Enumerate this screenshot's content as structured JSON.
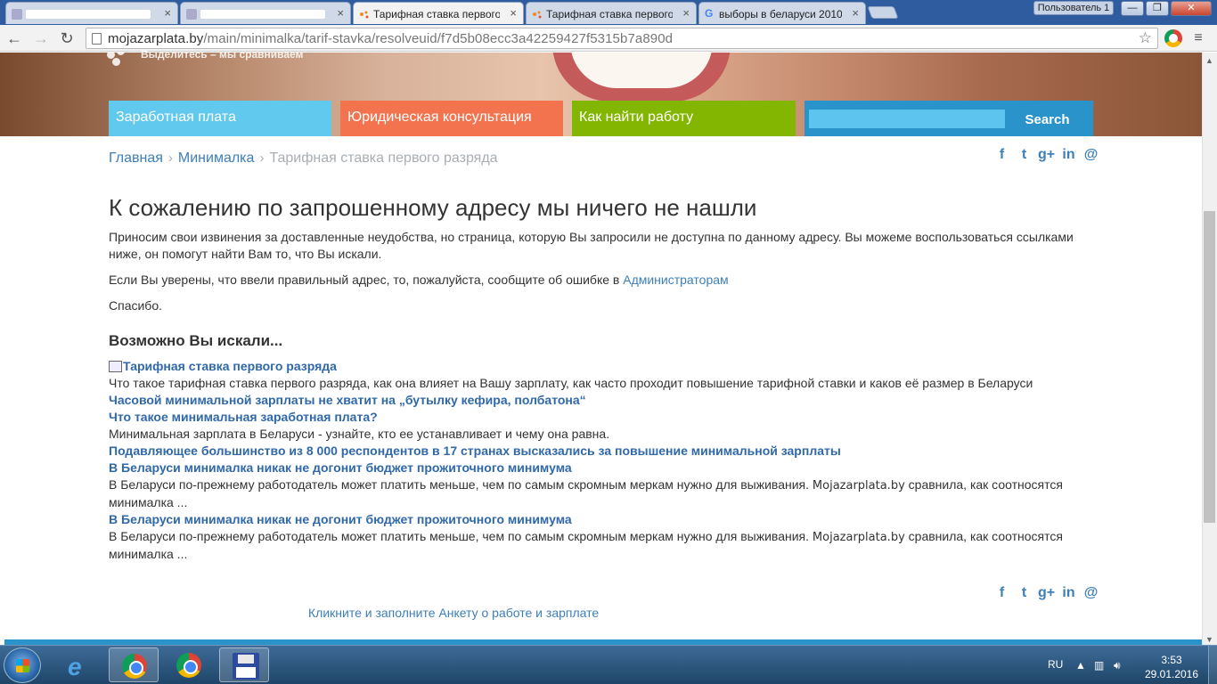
{
  "browser": {
    "tabs": [
      {
        "label": ""
      },
      {
        "label": ""
      },
      {
        "label": "Тарифная ставка первого"
      },
      {
        "label": "Тарифная ставка первого"
      },
      {
        "label": "выборы в беларуси 2010"
      }
    ],
    "profile_label": "Пользователь 1",
    "url_host": "mojazarplata.by",
    "url_path": "/main/minimalka/tarif-stavka/resolveuid/f7d5b08ecc3a42259427f5315b7a890d"
  },
  "site": {
    "slogan": "Выделитесь – мы сравниваем",
    "nav": {
      "salary": "Заработная плата",
      "legal": "Юридическая консультация",
      "job": "Как найти работу",
      "search_button": "Search",
      "search_placeholder": ""
    },
    "breadcrumb": {
      "home": "Главная",
      "section": "Минималка",
      "current": "Тарифная ставка первого разряда"
    },
    "social_icons": [
      "facebook-icon",
      "twitter-icon",
      "google-plus-icon",
      "linkedin-icon",
      "email-icon"
    ],
    "brand_colors": {
      "salary": "#61c8ee",
      "legal": "#f4734f",
      "job": "#83b600",
      "search": "#2a93c9",
      "link": "#3068a8"
    }
  },
  "content": {
    "heading": "К сожалению по запрошенному адресу мы ничего не нашли",
    "para1": "Приносим свои извинения за доставленные неудобства, но страница, которую Вы запросили не доступна по данному адресу. Вы можеме воспользоваться ссылками ниже, он помогут найти Вам то, что Вы искали.",
    "para2_prefix": "Если Вы уверены, что ввели правильный адрес, то, пожалуйста, сообщите об ошибке в ",
    "para2_link": "Администраторам",
    "para3": "Спасибо.",
    "subheading": "Возможно Вы искали...",
    "results": [
      {
        "title": "Тарифная ставка первого разряда",
        "desc": "Что такое тарифная ставка первого разряда, как она влияет на Вашу зарплату, как часто проходит повышение тарифной ставки и каков её размер в Беларуси"
      },
      {
        "title": "Часовой минимальной зарплаты не хватит на „бутылку кефира, полбатона“",
        "desc": ""
      },
      {
        "title": "Что такое минимальная заработная плата?",
        "desc": "Минимальная зарплата в Беларуси - узнайте, кто ее устанавливает и чему она равна."
      },
      {
        "title": "Подавляющее большинство из 8 000 респондентов в 17 странах высказались за повышение минимальной зарплаты",
        "desc": ""
      },
      {
        "title": "В Беларуси минималка никак не догонит бюджет прожиточного минимума",
        "desc_a": "В Беларуси по-прежнему работодатель может платить меньше, чем по самым скромным меркам нужно для выживания.",
        "desc_b": "Mojazarplata.by",
        "desc_c": "сравнила, как соотносятся минималка ..."
      },
      {
        "title": "В Беларуси минималка никак не догонит бюджет прожиточного минимума",
        "desc_a": "В Беларуси по-прежнему работодатель может платить меньше, чем по самым скромным меркам нужно для выживания.",
        "desc_b": "Mojazarplata.by",
        "desc_c": "сравнила, как соотносятся минималка ..."
      }
    ],
    "survey_link": "Кликните и заполните Анкету о работе и зарплате"
  },
  "taskbar": {
    "lang": "RU",
    "time": "3:53",
    "date": "29.01.2016"
  }
}
